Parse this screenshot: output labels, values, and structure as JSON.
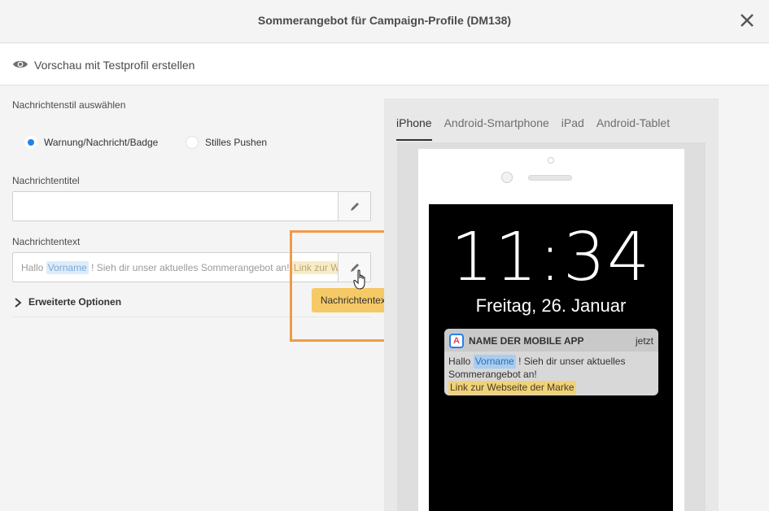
{
  "window": {
    "title": "Sommerangebot für Campaign-Profile (DM138)"
  },
  "preview_bar": {
    "icon": "eye-icon",
    "label": "Vorschau mit Testprofil erstellen"
  },
  "form": {
    "style_label": "Nachrichtenstil auswählen",
    "style_options": [
      {
        "label": "Warnung/Nachricht/Badge",
        "selected": true
      },
      {
        "label": "Stilles Pushen",
        "selected": false
      }
    ],
    "title_label": "Nachrichtentitel",
    "title_value": "",
    "text_label": "Nachrichtentext",
    "text_value": {
      "prefix": "Hallo",
      "token_name": "Vorname",
      "middle": "! Sieh dir unser aktuelles Sommerangebot an!",
      "token_link": "Link zur Webseite der Marke"
    },
    "advanced_label": "Erweiterte Optionen",
    "tooltip": "Nachrichtentext"
  },
  "preview": {
    "tabs": [
      {
        "label": "iPhone",
        "active": true
      },
      {
        "label": "Android-Smartphone",
        "active": false
      },
      {
        "label": "iPad",
        "active": false
      },
      {
        "label": "Android-Tablet",
        "active": false
      }
    ],
    "lock_screen": {
      "time": "11:34",
      "date": "Freitag, 26. Januar"
    },
    "notification": {
      "app_icon_letter": "A",
      "app_name": "NAME DER MOBILE APP",
      "time": "jetzt",
      "line_prefix": "Hallo",
      "token_name": "Vorname",
      "line_rest": "! Sieh dir unser aktuelles Sommerangebot an!",
      "token_link": "Link zur Webseite der Marke"
    }
  },
  "colors": {
    "accent": "#2680eb",
    "highlight_border": "#f19a46",
    "tooltip_bg": "#f5c966",
    "token_blue": "#dcecfb",
    "token_yellow": "#f8ecc7"
  }
}
